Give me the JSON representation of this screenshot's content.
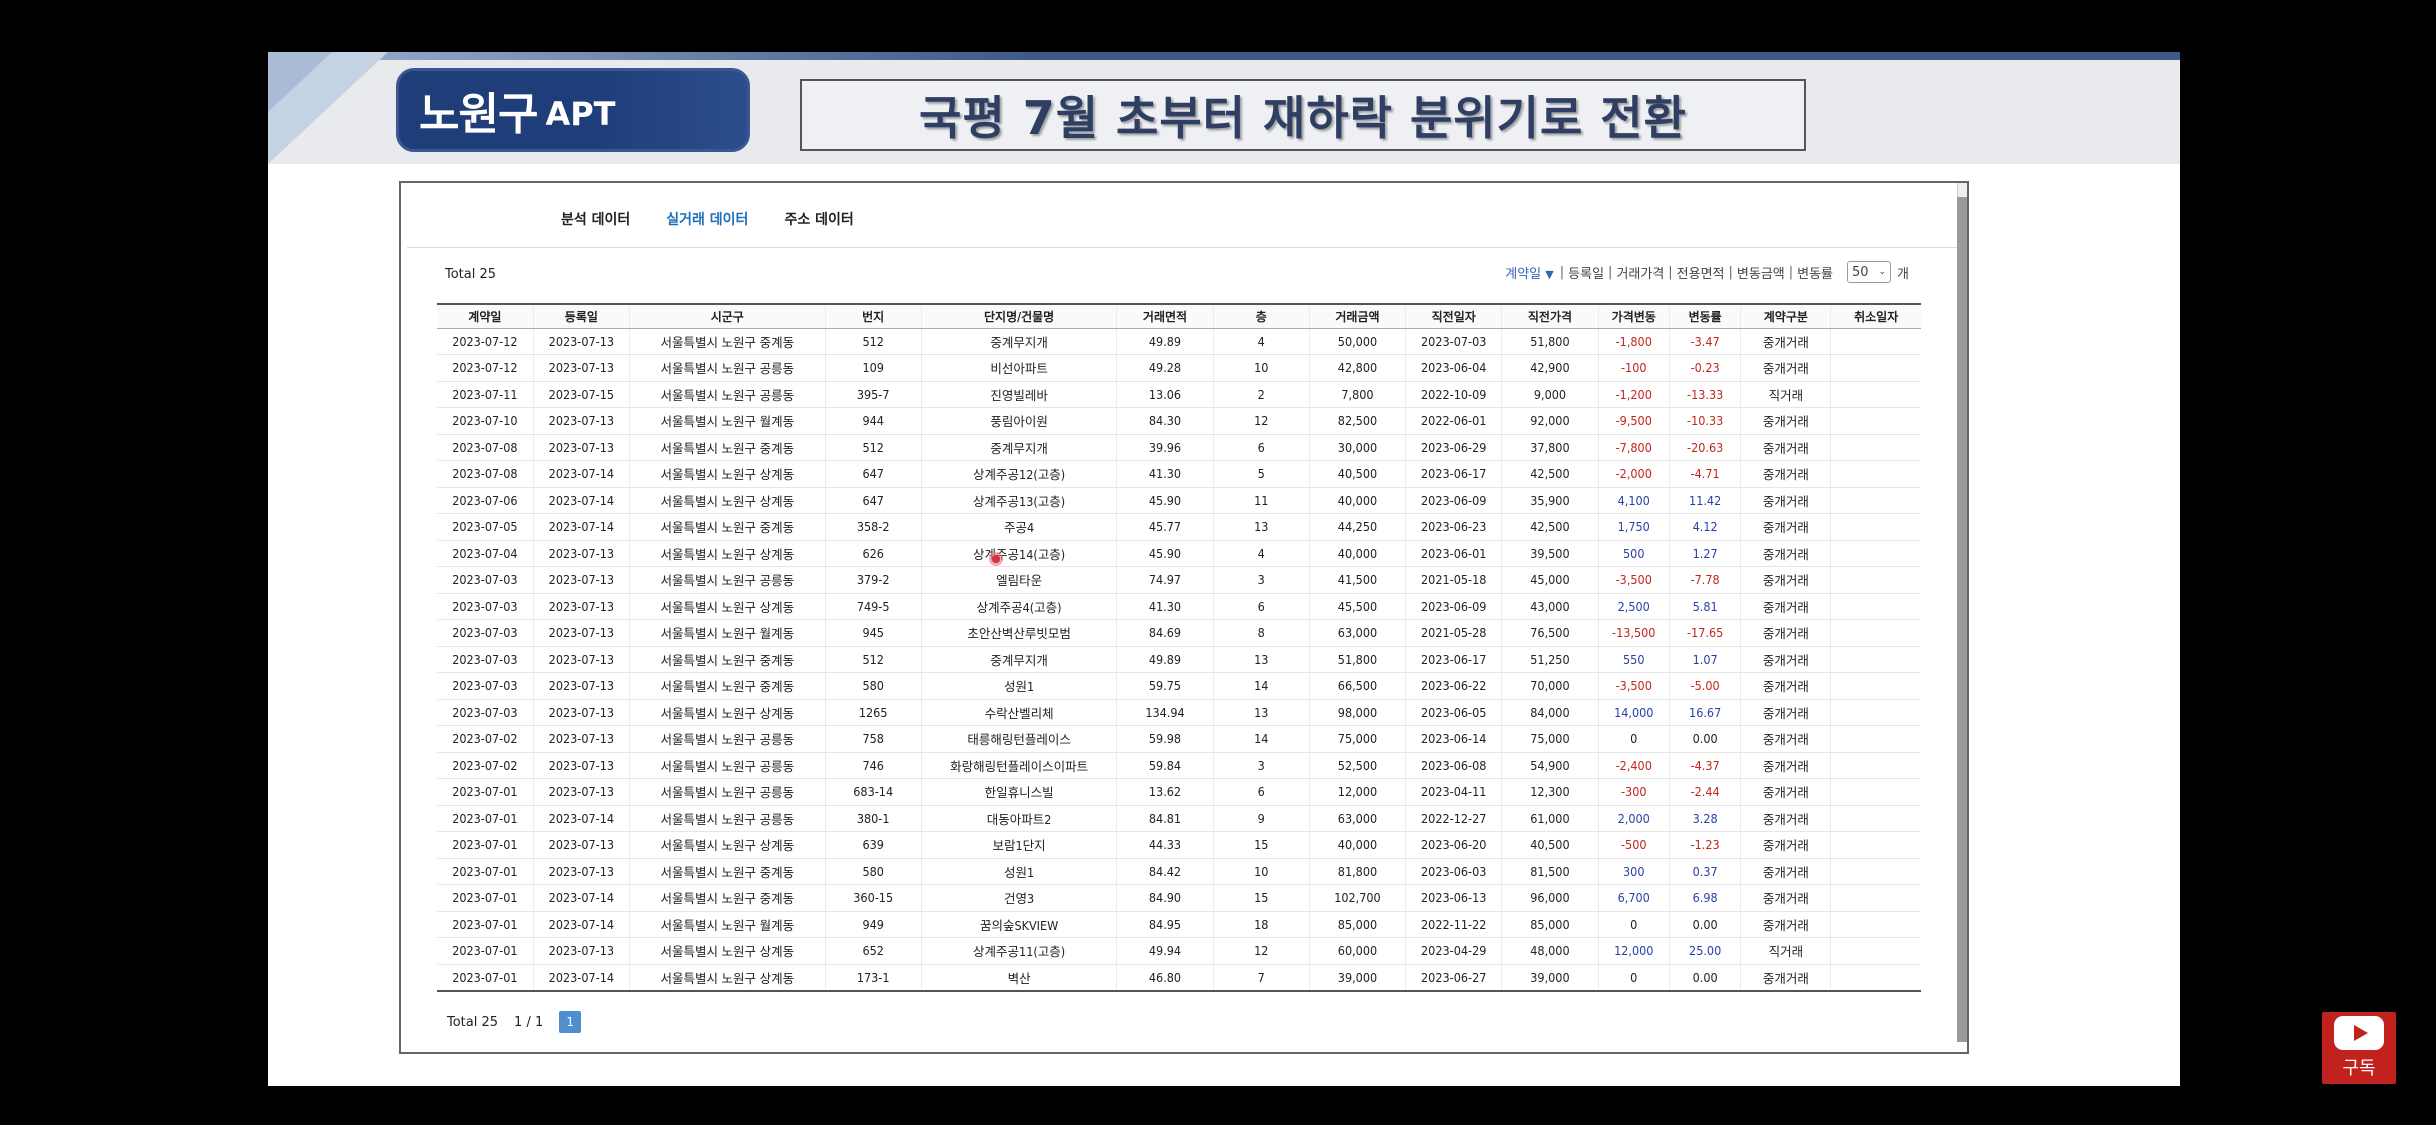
{
  "slide": {
    "badge_main": "노원구",
    "badge_sub": "APT",
    "headline": "국평 7월 초부터 재하락 분위기로 전환"
  },
  "tabs": [
    "분석 데이터",
    "실거래 데이터",
    "주소 데이터"
  ],
  "total_label": "Total 25",
  "sort": {
    "items": [
      "계약일",
      "등록일",
      "거래가격",
      "전용면적",
      "변동금액",
      "변동률"
    ],
    "page_size": "50",
    "unit": "개"
  },
  "table": {
    "headers": [
      "계약일",
      "등록일",
      "시군구",
      "번지",
      "단지명/건물명",
      "거래면적",
      "층",
      "거래금액",
      "직전일자",
      "직전가격",
      "가격변동",
      "변동률",
      "계약구분",
      "취소일자"
    ],
    "rows": [
      [
        "2023-07-12",
        "2023-07-13",
        "서울특별시 노원구 중계동",
        "512",
        "중계무지개",
        "49.89",
        "4",
        "50,000",
        "2023-07-03",
        "51,800",
        "-1,800",
        "-3.47",
        "중개거래",
        ""
      ],
      [
        "2023-07-12",
        "2023-07-13",
        "서울특별시 노원구 공릉동",
        "109",
        "비선아파트",
        "49.28",
        "10",
        "42,800",
        "2023-06-04",
        "42,900",
        "-100",
        "-0.23",
        "중개거래",
        ""
      ],
      [
        "2023-07-11",
        "2023-07-15",
        "서울특별시 노원구 공릉동",
        "395-7",
        "진영빌레바",
        "13.06",
        "2",
        "7,800",
        "2022-10-09",
        "9,000",
        "-1,200",
        "-13.33",
        "직거래",
        ""
      ],
      [
        "2023-07-10",
        "2023-07-13",
        "서울특별시 노원구 월계동",
        "944",
        "풍림아이원",
        "84.30",
        "12",
        "82,500",
        "2022-06-01",
        "92,000",
        "-9,500",
        "-10.33",
        "중개거래",
        ""
      ],
      [
        "2023-07-08",
        "2023-07-13",
        "서울특별시 노원구 중계동",
        "512",
        "중계무지개",
        "39.96",
        "6",
        "30,000",
        "2023-06-29",
        "37,800",
        "-7,800",
        "-20.63",
        "중개거래",
        ""
      ],
      [
        "2023-07-08",
        "2023-07-14",
        "서울특별시 노원구 상계동",
        "647",
        "상계주공12(고층)",
        "41.30",
        "5",
        "40,500",
        "2023-06-17",
        "42,500",
        "-2,000",
        "-4.71",
        "중개거래",
        ""
      ],
      [
        "2023-07-06",
        "2023-07-14",
        "서울특별시 노원구 상계동",
        "647",
        "상계주공13(고층)",
        "45.90",
        "11",
        "40,000",
        "2023-06-09",
        "35,900",
        "4,100",
        "11.42",
        "중개거래",
        ""
      ],
      [
        "2023-07-05",
        "2023-07-14",
        "서울특별시 노원구 중계동",
        "358-2",
        "주공4",
        "45.77",
        "13",
        "44,250",
        "2023-06-23",
        "42,500",
        "1,750",
        "4.12",
        "중개거래",
        ""
      ],
      [
        "2023-07-04",
        "2023-07-13",
        "서울특별시 노원구 상계동",
        "626",
        "상계주공14(고층)",
        "45.90",
        "4",
        "40,000",
        "2023-06-01",
        "39,500",
        "500",
        "1.27",
        "중개거래",
        ""
      ],
      [
        "2023-07-03",
        "2023-07-13",
        "서울특별시 노원구 공릉동",
        "379-2",
        "엘림타운",
        "74.97",
        "3",
        "41,500",
        "2021-05-18",
        "45,000",
        "-3,500",
        "-7.78",
        "중개거래",
        ""
      ],
      [
        "2023-07-03",
        "2023-07-13",
        "서울특별시 노원구 상계동",
        "749-5",
        "상계주공4(고층)",
        "41.30",
        "6",
        "45,500",
        "2023-06-09",
        "43,000",
        "2,500",
        "5.81",
        "중개거래",
        ""
      ],
      [
        "2023-07-03",
        "2023-07-13",
        "서울특별시 노원구 월계동",
        "945",
        "초안산벽산루빗모범",
        "84.69",
        "8",
        "63,000",
        "2021-05-28",
        "76,500",
        "-13,500",
        "-17.65",
        "중개거래",
        ""
      ],
      [
        "2023-07-03",
        "2023-07-13",
        "서울특별시 노원구 중계동",
        "512",
        "중계무지개",
        "49.89",
        "13",
        "51,800",
        "2023-06-17",
        "51,250",
        "550",
        "1.07",
        "중개거래",
        ""
      ],
      [
        "2023-07-03",
        "2023-07-13",
        "서울특별시 노원구 중계동",
        "580",
        "성원1",
        "59.75",
        "14",
        "66,500",
        "2023-06-22",
        "70,000",
        "-3,500",
        "-5.00",
        "중개거래",
        ""
      ],
      [
        "2023-07-03",
        "2023-07-13",
        "서울특별시 노원구 상계동",
        "1265",
        "수락산벨리체",
        "134.94",
        "13",
        "98,000",
        "2023-06-05",
        "84,000",
        "14,000",
        "16.67",
        "중개거래",
        ""
      ],
      [
        "2023-07-02",
        "2023-07-13",
        "서울특별시 노원구 공릉동",
        "758",
        "태릉해링턴플레이스",
        "59.98",
        "14",
        "75,000",
        "2023-06-14",
        "75,000",
        "0",
        "0.00",
        "중개거래",
        ""
      ],
      [
        "2023-07-02",
        "2023-07-13",
        "서울특별시 노원구 공릉동",
        "746",
        "화랑해링턴플레이스이파트",
        "59.84",
        "3",
        "52,500",
        "2023-06-08",
        "54,900",
        "-2,400",
        "-4.37",
        "중개거래",
        ""
      ],
      [
        "2023-07-01",
        "2023-07-13",
        "서울특별시 노원구 공릉동",
        "683-14",
        "한일휴니스빌",
        "13.62",
        "6",
        "12,000",
        "2023-04-11",
        "12,300",
        "-300",
        "-2.44",
        "중개거래",
        ""
      ],
      [
        "2023-07-01",
        "2023-07-14",
        "서울특별시 노원구 공릉동",
        "380-1",
        "대동아파트2",
        "84.81",
        "9",
        "63,000",
        "2022-12-27",
        "61,000",
        "2,000",
        "3.28",
        "중개거래",
        ""
      ],
      [
        "2023-07-01",
        "2023-07-13",
        "서울특별시 노원구 상계동",
        "639",
        "보람1단지",
        "44.33",
        "15",
        "40,000",
        "2023-06-20",
        "40,500",
        "-500",
        "-1.23",
        "중개거래",
        ""
      ],
      [
        "2023-07-01",
        "2023-07-13",
        "서울특별시 노원구 중계동",
        "580",
        "성원1",
        "84.42",
        "10",
        "81,800",
        "2023-06-03",
        "81,500",
        "300",
        "0.37",
        "중개거래",
        ""
      ],
      [
        "2023-07-01",
        "2023-07-14",
        "서울특별시 노원구 중계동",
        "360-15",
        "건영3",
        "84.90",
        "15",
        "102,700",
        "2023-06-13",
        "96,000",
        "6,700",
        "6.98",
        "중개거래",
        ""
      ],
      [
        "2023-07-01",
        "2023-07-14",
        "서울특별시 노원구 월계동",
        "949",
        "꿈의숲SKVIEW",
        "84.95",
        "18",
        "85,000",
        "2022-11-22",
        "85,000",
        "0",
        "0.00",
        "중개거래",
        ""
      ],
      [
        "2023-07-01",
        "2023-07-13",
        "서울특별시 노원구 상계동",
        "652",
        "상계주공11(고층)",
        "49.94",
        "12",
        "60,000",
        "2023-04-29",
        "48,000",
        "12,000",
        "25.00",
        "직거래",
        ""
      ],
      [
        "2023-07-01",
        "2023-07-14",
        "서울특별시 노원구 상계동",
        "173-1",
        "벽산",
        "46.80",
        "7",
        "39,000",
        "2023-06-27",
        "39,000",
        "0",
        "0.00",
        "중개거래",
        ""
      ]
    ]
  },
  "pagination": {
    "total": "Total 25",
    "page_count": "1 / 1",
    "current": "1"
  },
  "youtube": {
    "subscribe_label": "구독"
  }
}
